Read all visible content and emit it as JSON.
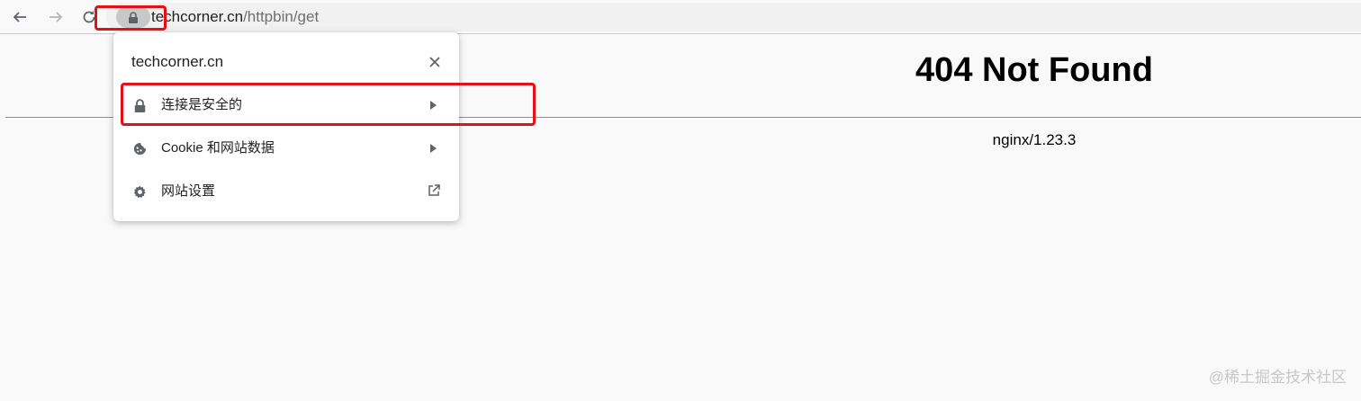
{
  "browser": {
    "url_host": "techcorner.cn",
    "url_path": "/httpbin/get"
  },
  "page": {
    "heading": "404 Not Found",
    "server": "nginx/1.23.3"
  },
  "site_info_popup": {
    "title": "techcorner.cn",
    "items": [
      {
        "label": "连接是安全的",
        "icon": "lock-icon",
        "trailing": "triangle-right-icon"
      },
      {
        "label": "Cookie 和网站数据",
        "icon": "cookie-icon",
        "trailing": "triangle-right-icon"
      },
      {
        "label": "网站设置",
        "icon": "gear-icon",
        "trailing": "external-link-icon"
      }
    ]
  },
  "annotations": {
    "highlight_color": "#e3101a"
  },
  "watermark": "@稀土掘金技术社区"
}
